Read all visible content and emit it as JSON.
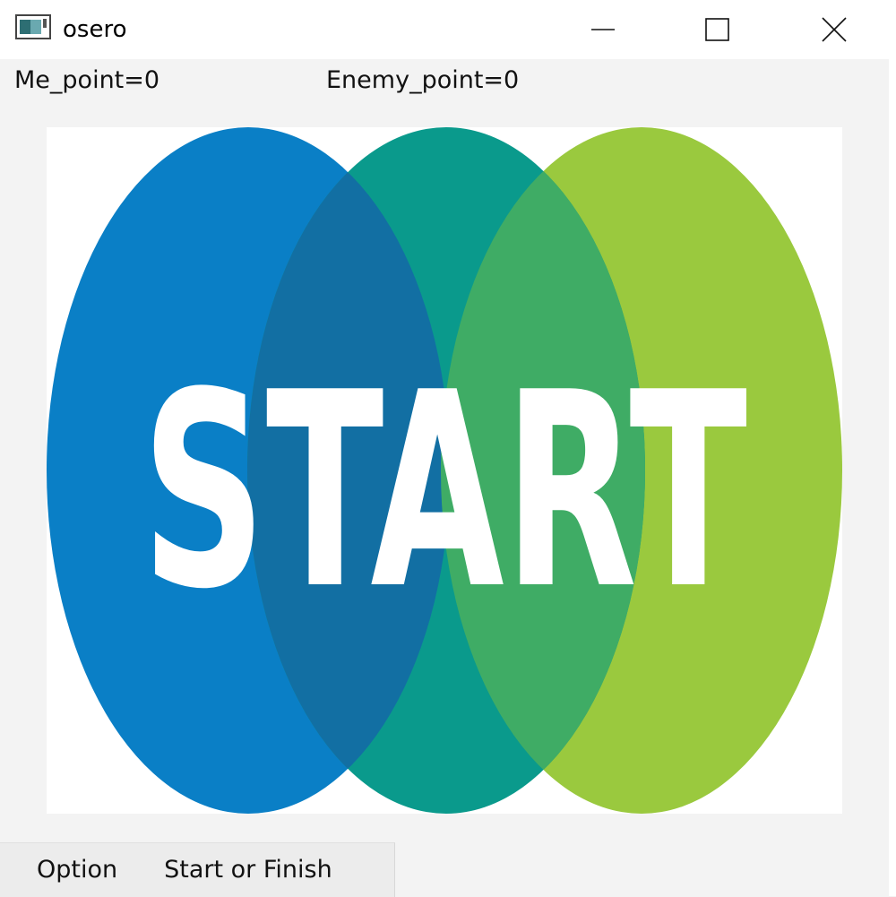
{
  "window": {
    "title": "osero",
    "controls": {
      "minimize": "minimize-icon",
      "maximize": "maximize-icon",
      "close": "close-icon"
    }
  },
  "scores": {
    "me": "Me_point=0",
    "enemy": "Enemy_point=0"
  },
  "start_image": {
    "text": "START",
    "colors": {
      "blue": "#0a7fc6",
      "teal": "#0a9a8c",
      "green": "#9ac93e",
      "overlap_left": "#126fa3",
      "overlap_right": "#3fac65"
    }
  },
  "menu": {
    "items": [
      "Option",
      "Start or Finish"
    ]
  }
}
